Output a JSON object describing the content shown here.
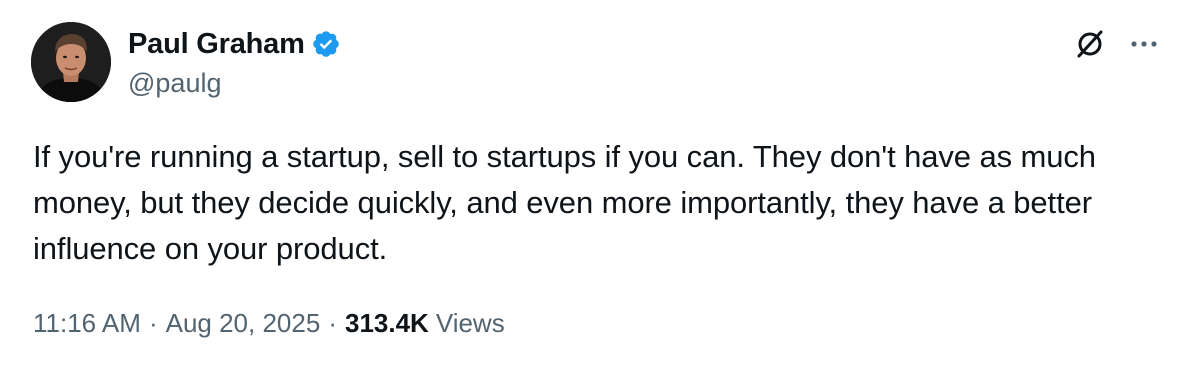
{
  "author": {
    "name": "Paul Graham",
    "handle": "@paulg",
    "verified": true,
    "verified_color": "#1d9bf0"
  },
  "header_actions": {
    "grok_icon": "grok-icon",
    "more_icon": "more-options-icon",
    "more_label": "···"
  },
  "tweet": {
    "text": "If you're running a startup, sell to startups if you can. They don't have as much money, but they decide quickly, and even more importantly, they have a better influence on your product."
  },
  "meta": {
    "time": "11:16 AM",
    "separator": "·",
    "date": "Aug 20, 2025",
    "views_count": "313.4K",
    "views_label": "Views"
  },
  "colors": {
    "text_primary": "#0f1419",
    "text_secondary": "#536471",
    "accent": "#1d9bf0",
    "background": "#ffffff"
  }
}
